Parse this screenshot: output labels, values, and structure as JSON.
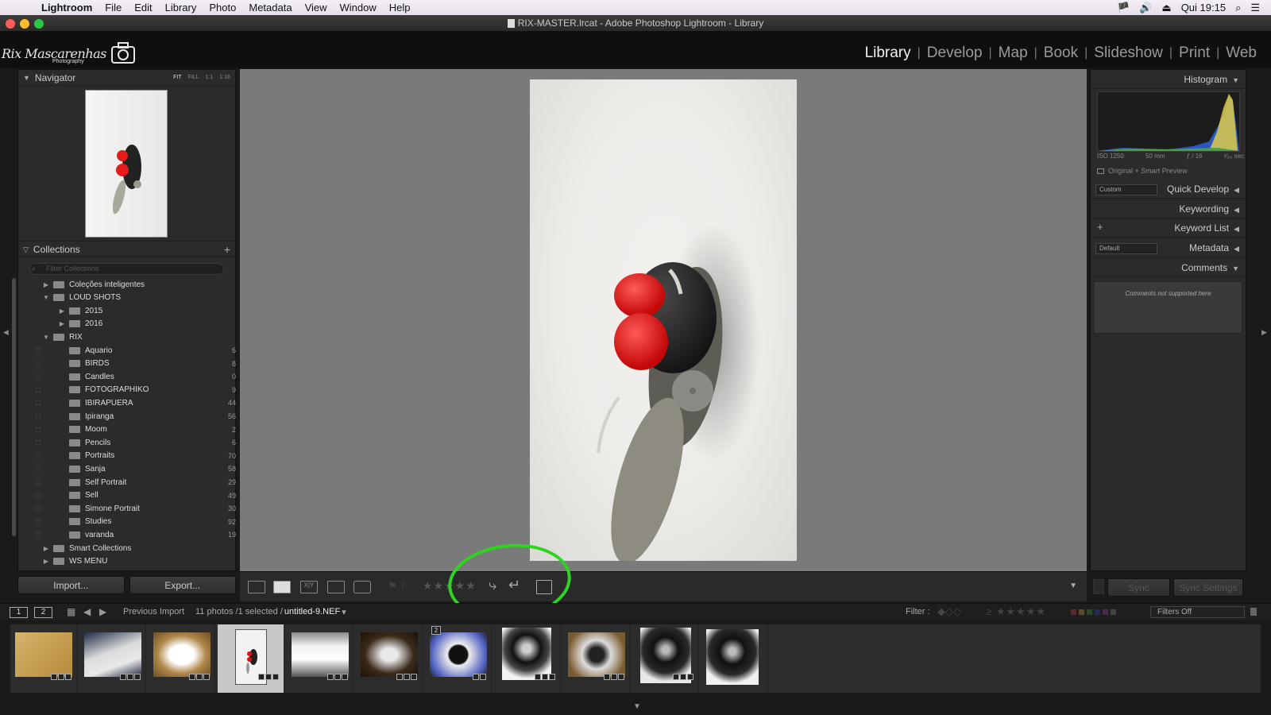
{
  "menubar": {
    "app_name": "Lightroom",
    "items": [
      "File",
      "Edit",
      "Library",
      "Photo",
      "Metadata",
      "View",
      "Window",
      "Help"
    ],
    "clock": "Qui 19:15"
  },
  "window": {
    "title": "RIX-MASTER.lrcat - Adobe Photoshop Lightroom - Library"
  },
  "logo": {
    "text": "Rix Mascarenhas",
    "subtext": "Photography"
  },
  "modules": [
    {
      "label": "Library",
      "active": true
    },
    {
      "label": "Develop"
    },
    {
      "label": "Map"
    },
    {
      "label": "Book"
    },
    {
      "label": "Slideshow"
    },
    {
      "label": "Print"
    },
    {
      "label": "Web"
    }
  ],
  "navigator": {
    "title": "Navigator",
    "zoom_fit": "FIT",
    "zoom_fill": "FILL",
    "zoom_1": "1:1",
    "zoom_custom": "1:16"
  },
  "collections": {
    "title": "Collections",
    "add_label": "+",
    "filter_placeholder": "Filter Collections",
    "rows": [
      {
        "label": "Coleções inteligentes",
        "count": "",
        "indent": 0,
        "arrow": "▶"
      },
      {
        "label": "LOUD SHOTS",
        "count": "",
        "indent": 0,
        "arrow": "▼"
      },
      {
        "label": "2015",
        "count": "",
        "indent": 1,
        "arrow": "▶"
      },
      {
        "label": "2016",
        "count": "",
        "indent": 1,
        "arrow": "▶"
      },
      {
        "label": "RIX",
        "count": "",
        "indent": 0,
        "arrow": "▼"
      },
      {
        "label": "Aquario",
        "count": "6",
        "indent": 1,
        "arrow": ""
      },
      {
        "label": "BIRDS",
        "count": "8",
        "indent": 1,
        "arrow": ""
      },
      {
        "label": "Candles",
        "count": "0",
        "indent": 1,
        "arrow": ""
      },
      {
        "label": "FOTOGRAPHIKO",
        "count": "9",
        "indent": 1,
        "arrow": ""
      },
      {
        "label": "IBIRAPUERA",
        "count": "44",
        "indent": 1,
        "arrow": ""
      },
      {
        "label": "Ipiranga",
        "count": "56",
        "indent": 1,
        "arrow": ""
      },
      {
        "label": "Moom",
        "count": "2",
        "indent": 1,
        "arrow": ""
      },
      {
        "label": "Pencils",
        "count": "6",
        "indent": 1,
        "arrow": ""
      },
      {
        "label": "Portraits",
        "count": "70",
        "indent": 1,
        "arrow": ""
      },
      {
        "label": "Sanja",
        "count": "58",
        "indent": 1,
        "arrow": ""
      },
      {
        "label": "Self Portrait",
        "count": "29",
        "indent": 1,
        "arrow": ""
      },
      {
        "label": "Sell",
        "count": "49",
        "indent": 1,
        "arrow": ""
      },
      {
        "label": "Simone Portrait",
        "count": "30",
        "indent": 1,
        "arrow": ""
      },
      {
        "label": "Studies",
        "count": "92",
        "indent": 1,
        "arrow": ""
      },
      {
        "label": "varanda",
        "count": "19",
        "indent": 1,
        "arrow": ""
      },
      {
        "label": "Smart Collections",
        "count": "",
        "indent": 0,
        "arrow": "▶"
      },
      {
        "label": "WS MENU",
        "count": "",
        "indent": 0,
        "arrow": "▶"
      }
    ]
  },
  "left_buttons": {
    "import": "Import...",
    "export": "Export..."
  },
  "right_panel": {
    "histogram": "Histogram",
    "iso": "ISO 1250",
    "focal": "50 mm",
    "aperture": "ƒ / 16",
    "shutter": "¹⁄₆₀ sec",
    "preview": "Original + Smart Preview",
    "quick_develop": "Quick Develop",
    "quick_preset": "Custom",
    "keywording": "Keywording",
    "keyword_list": "Keyword List",
    "metadata": "Metadata",
    "metadata_preset": "Default",
    "comments": "Comments",
    "comments_note": "Comments not supported here",
    "sync": "Sync",
    "sync_settings": "Sync Settings"
  },
  "filmbar": {
    "page1": "1",
    "page2": "2",
    "source": "Previous Import",
    "status": "11 photos /1 selected /",
    "filename": "untitled-9.NEF",
    "filter_label": "Filter :",
    "filters_off": "Filters Off"
  },
  "filmstrip": {
    "stack_count": "2",
    "thumbs": [
      {
        "kind": "wood-box",
        "selected": false
      },
      {
        "kind": "paper",
        "selected": false
      },
      {
        "kind": "lightbox",
        "selected": false
      },
      {
        "kind": "fly",
        "selected": true
      },
      {
        "kind": "white-box",
        "selected": false
      },
      {
        "kind": "dark-box",
        "selected": false
      },
      {
        "kind": "lens-stack",
        "selected": false
      },
      {
        "kind": "lens",
        "selected": false
      },
      {
        "kind": "lens-box",
        "selected": false
      },
      {
        "kind": "lens-black",
        "selected": false
      },
      {
        "kind": "lens-black",
        "selected": false
      }
    ]
  },
  "colors": {
    "annotation": "#2ed51e",
    "background": "#1a1a1a",
    "center": "#7a7a7a"
  }
}
